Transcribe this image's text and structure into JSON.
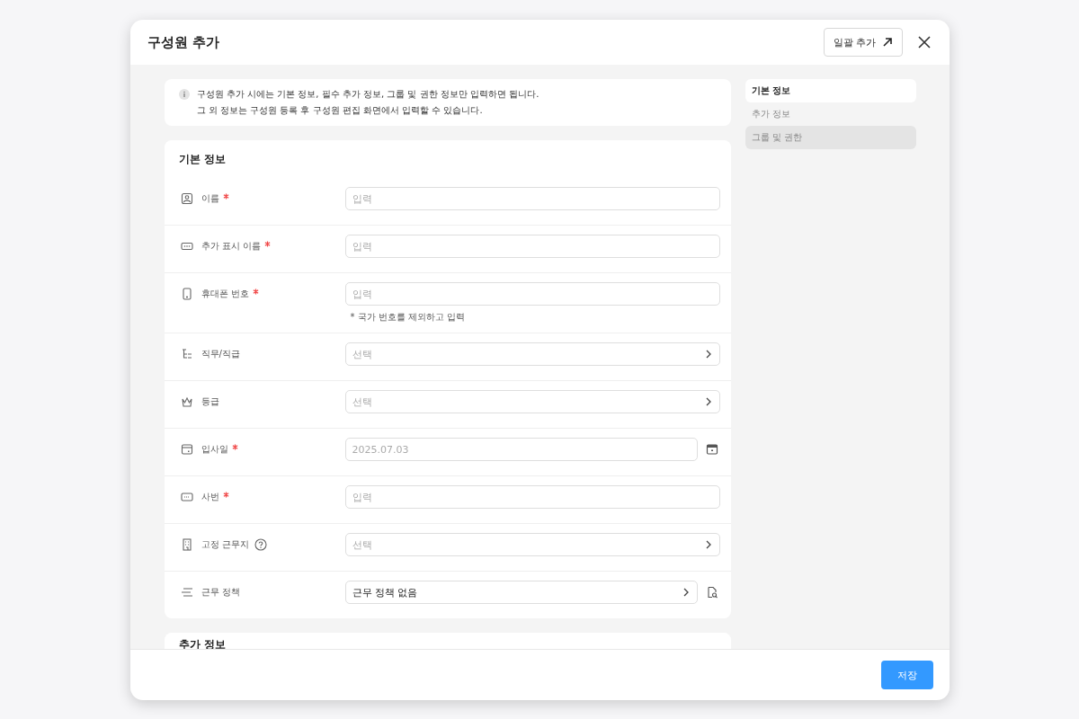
{
  "dialog": {
    "title": "구성원 추가",
    "bulk_button": "일괄 추가"
  },
  "notice": [
    "구성원 추가 시에는 기본 정보, 필수 추가 정보, 그룹 및 권한 정보만 입력하면 됩니다.",
    "그 외 정보는 구성원 등록 후 구성원 편집 화면에서 입력할 수 있습니다."
  ],
  "basic_section": {
    "title": "기본 정보",
    "fields": [
      {
        "label": "이름",
        "required": true,
        "kind": "input",
        "placeholder": "입력"
      },
      {
        "label": "추가 표시 이름",
        "required": true,
        "kind": "input",
        "placeholder": "입력"
      },
      {
        "label": "휴대폰 번호",
        "required": true,
        "kind": "input",
        "placeholder": "입력",
        "hint": "* 국가 번호를 제외하고 입력"
      },
      {
        "label": "직무/직급",
        "required": false,
        "kind": "select",
        "placeholder": "선택"
      },
      {
        "label": "등급",
        "required": false,
        "kind": "select",
        "placeholder": "선택"
      },
      {
        "label": "입사일",
        "required": true,
        "kind": "date",
        "placeholder": "2025.07.03"
      },
      {
        "label": "사번",
        "required": true,
        "kind": "input",
        "placeholder": "입력"
      },
      {
        "label": "고정 근무지",
        "required": false,
        "help": true,
        "kind": "select",
        "placeholder": "선택"
      },
      {
        "label": "근무 정책",
        "required": false,
        "kind": "select",
        "value": "근무 정책 없음",
        "preview": true
      }
    ]
  },
  "extra_section": {
    "title": "추가 정보"
  },
  "nav": [
    {
      "label": "기본 정보",
      "selected": true,
      "hovered": false
    },
    {
      "label": "추가 정보",
      "selected": false,
      "hovered": false
    },
    {
      "label": "그룹 및 권한",
      "selected": false,
      "hovered": true
    }
  ],
  "footer": {
    "save_button": "저장"
  }
}
